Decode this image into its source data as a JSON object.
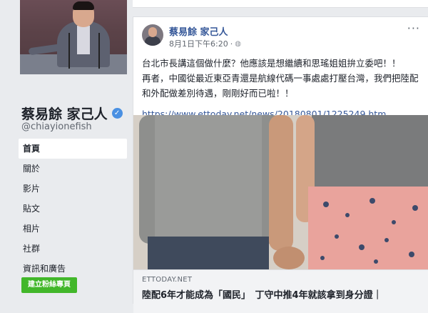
{
  "page": {
    "name": "蔡易餘 家己人",
    "handle": "@chiayionefish",
    "nav": [
      "首頁",
      "關於",
      "影片",
      "貼文",
      "相片",
      "社群",
      "資訊和廣告"
    ],
    "create_button": "建立粉絲專頁"
  },
  "post": {
    "author": "蔡易餘 家己人",
    "time": "8月1日下午6:20",
    "privacy_icon": "globe-icon",
    "more_icon": "more-options-icon",
    "paragraph1": "台北市長講這個做什麼？他應該是想繼續和思瑤姐姐拚立委吧！！",
    "paragraph2": "再者，中國從最近東亞青還是航線代碼一事處處打壓台灣，我們把陸配和外配做差別待遇，剛剛好而已啦！！",
    "link": "https://www.ettoday.net/news/20180801/1225249.htm",
    "card": {
      "source": "ETTODAY.NET",
      "headline": "陸配6年才能成為「國民」　丁守中推4年就該拿到身分證｜"
    }
  },
  "colors": {
    "link": "#365899",
    "verified": "#4a90e2",
    "create_button": "#42b72a",
    "background": "#e9ebee"
  }
}
